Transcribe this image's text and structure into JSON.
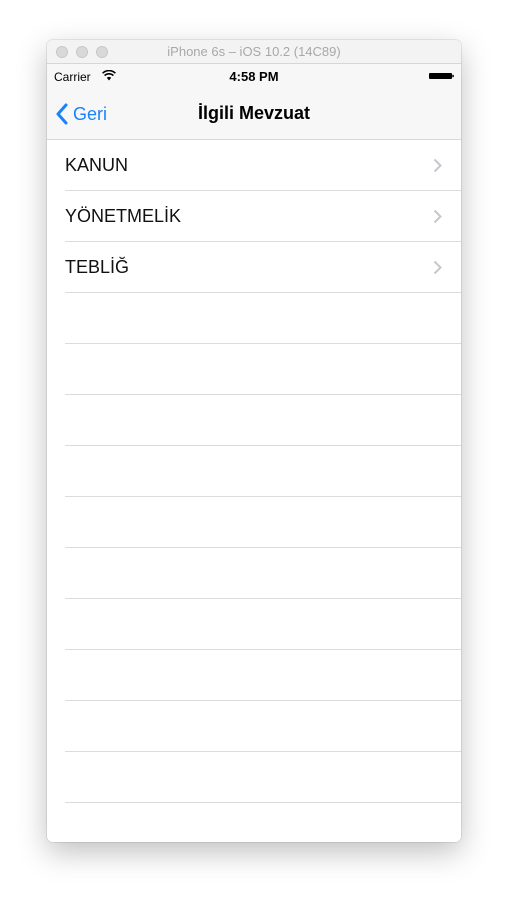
{
  "window": {
    "title": "iPhone 6s – iOS 10.2 (14C89)"
  },
  "status_bar": {
    "carrier": "Carrier",
    "time": "4:58 PM",
    "wifi_icon": "wifi-icon",
    "battery_icon": "battery-icon"
  },
  "nav_bar": {
    "back_label": "Geri",
    "back_icon": "chevron-left-icon",
    "title": "İlgili Mevzuat"
  },
  "list": {
    "items": [
      {
        "label": "KANUN"
      },
      {
        "label": "YÖNETMELİK"
      },
      {
        "label": "TEBLİĞ"
      }
    ],
    "disclosure_icon": "chevron-right-icon",
    "empty_rows": 10
  },
  "colors": {
    "accent": "#1a82fb",
    "separator": "#dcdcdc",
    "navbar_bg": "#f7f7f7"
  }
}
